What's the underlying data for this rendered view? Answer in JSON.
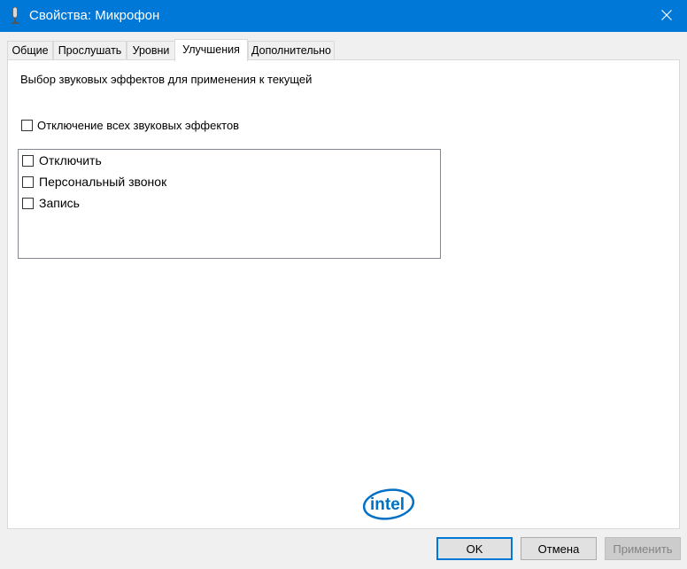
{
  "window": {
    "title": "Свойства: Микрофон",
    "icon": "microphone-icon",
    "close_icon": "close-icon"
  },
  "tabs": [
    {
      "label": "Общие",
      "active": false
    },
    {
      "label": "Прослушать",
      "active": false
    },
    {
      "label": "Уровни",
      "active": false
    },
    {
      "label": "Улучшения",
      "active": true
    },
    {
      "label": "Дополнительно",
      "active": false
    }
  ],
  "enhancements": {
    "description": "Выбор звуковых эффектов для применения к текущей",
    "disable_all": {
      "label": "Отключение всех звуковых эффектов",
      "checked": false
    },
    "effects": [
      {
        "label": "Отключить",
        "checked": false
      },
      {
        "label": "Персональный звонок",
        "checked": false
      },
      {
        "label": "Запись",
        "checked": false
      }
    ],
    "logo": {
      "text": "intel",
      "color": "#0071c5"
    }
  },
  "buttons": {
    "ok": "OK",
    "cancel": "Отмена",
    "apply": "Применить"
  },
  "colors": {
    "titlebar": "#0078d7",
    "accent": "#0078d7"
  }
}
